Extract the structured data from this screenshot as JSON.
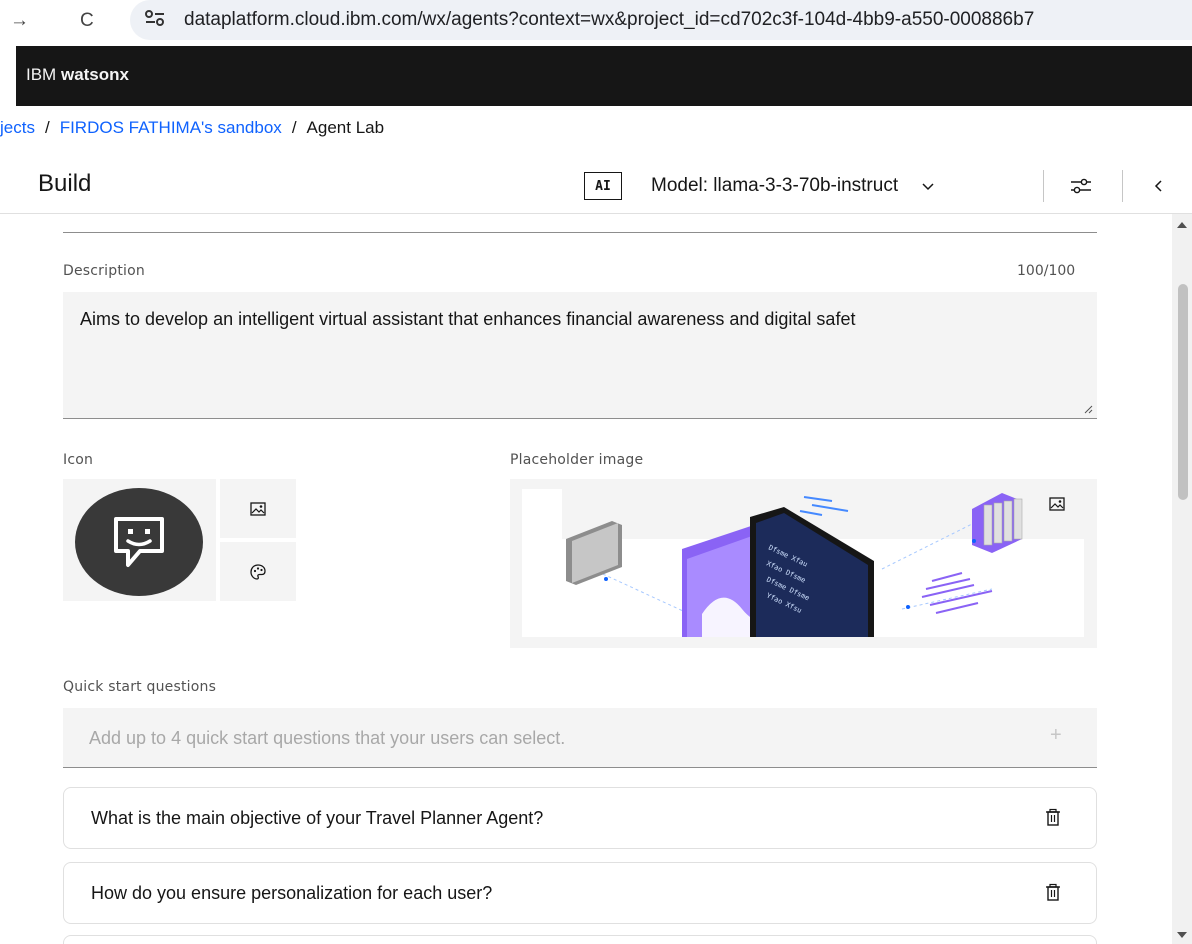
{
  "browser": {
    "url": "dataplatform.cloud.ibm.com/wx/agents?context=wx&project_id=cd702c3f-104d-4bb9-a550-000886b7"
  },
  "header": {
    "brand_prefix": "IBM",
    "brand_name": "watsonx"
  },
  "breadcrumb": {
    "items": [
      "jects",
      "FIRDOS FATHIMA's sandbox",
      "Agent Lab"
    ],
    "separator": "/"
  },
  "build_bar": {
    "title": "Build",
    "ai_badge": "AI",
    "model_label": "Model: llama-3-3-70b-instruct"
  },
  "form": {
    "description": {
      "label": "Description",
      "counter": "100/100",
      "value": "Aims to develop an intelligent virtual assistant that enhances financial awareness and digital safet"
    },
    "icon": {
      "label": "Icon"
    },
    "placeholder_image": {
      "label": "Placeholder image"
    },
    "quick_start": {
      "label": "Quick start questions",
      "placeholder": "Add up to 4 quick start questions that your users can select.",
      "questions": [
        "What is the main objective of your Travel Planner Agent?",
        "How do you ensure personalization for each user?"
      ]
    }
  },
  "colors": {
    "header_bg": "#161616",
    "link": "#0f62fe",
    "field_bg": "#f4f4f4",
    "avatar_bg": "#393939",
    "art_purple": "#8a63f5"
  }
}
